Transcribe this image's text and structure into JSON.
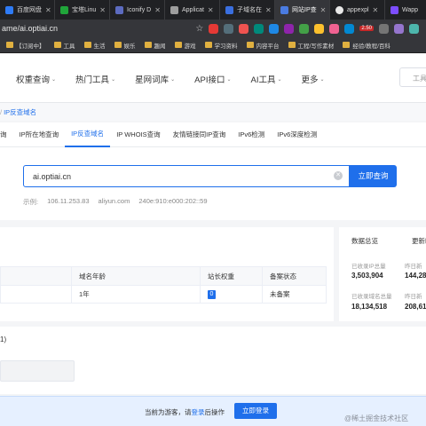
{
  "browser": {
    "tabs": [
      {
        "label": "百度网盘",
        "color": "#2e7bf6",
        "active": false
      },
      {
        "label": "宝塔Linu",
        "color": "#20a53a",
        "active": false
      },
      {
        "label": "Iconify D",
        "color": "#5c6bc0",
        "active": false
      },
      {
        "label": "Applicat",
        "color": "#9e9e9e",
        "active": false
      },
      {
        "label": "子域名在",
        "color": "#3a6fe0",
        "active": false
      },
      {
        "label": "网站IP查",
        "color": "#4a7be0",
        "active": true
      },
      {
        "label": "appexpl",
        "color": "#e8e8e8",
        "active": false
      },
      {
        "label": "Wapp",
        "color": "#7c4dff",
        "active": false
      }
    ],
    "address": "ame/ai.optiai.cn",
    "extension_badge": "2.50",
    "bookmarks": [
      "【订阅中】",
      "工具",
      "生活",
      "娱乐",
      "趣闻",
      "游戏",
      "学习资料",
      "内容平台",
      "工程/写作素材",
      "经验/教程/百科"
    ]
  },
  "site_nav": {
    "items": [
      "权重查询",
      "热门工具",
      "星网词库",
      "API接口",
      "AI工具",
      "更多"
    ],
    "toolbox_label": "工具"
  },
  "breadcrumb": {
    "current": "IP反查域名"
  },
  "subtabs": [
    "询",
    "IP所在地查询",
    "IP反查域名",
    "IP WHOIS查询",
    "友情链接同IP查询",
    "IPv6检测",
    "IPv6深度检测"
  ],
  "search": {
    "value": "ai.optiai.cn",
    "button": "立即查询",
    "example_label": "示例:",
    "examples": [
      "106.11.253.83",
      "aliyun.com",
      "240e:910:e000:202::59"
    ]
  },
  "results_table": {
    "headers": [
      "域名年龄",
      "站长权重",
      "备案状态"
    ],
    "row": {
      "age": "1年",
      "weight": "0",
      "icp": "未备案"
    }
  },
  "stats": {
    "title": "数据总览",
    "title2": "更新时",
    "ip_total_label": "已收录IP总量",
    "ip_total": "3,503,904",
    "ip_new_label": "昨日新",
    "ip_new": "144,28",
    "domain_total_label": "已收录域名总量",
    "domain_total": "18,134,518",
    "domain_new_label": "昨日新",
    "domain_new": "208,61"
  },
  "section2": {
    "count": "1)"
  },
  "footer": {
    "text_prefix": "当前为游客，请",
    "link": "登录",
    "text_suffix": "后操作",
    "button": "立即登录"
  },
  "watermark": "@稀土掘金技术社区",
  "colors": {
    "accent": "#1f6feb",
    "tab_bg": "#202124",
    "active_tab": "#35363a"
  }
}
